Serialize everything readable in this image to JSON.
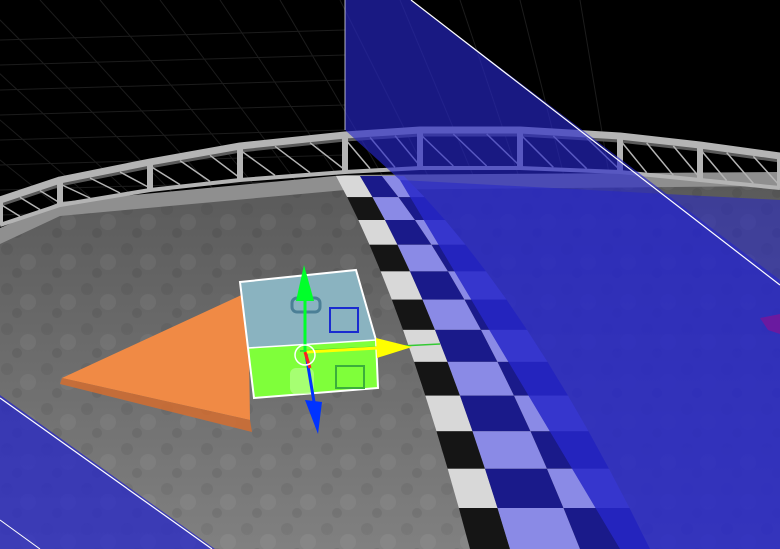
{
  "viewport": {
    "background_color": "#000000",
    "grid_color": "#1c1c1c"
  },
  "scene": {
    "floor_color": "#6e6e6e",
    "floor_dark_color": "#4c4c4c",
    "track_strip_dark": "#151515",
    "track_strip_light": "#d8d8d8",
    "railing_color": "#b4b4b4",
    "railing_shadow_color": "#5a5a5a"
  },
  "selection": {
    "volume_color": "#2626c8",
    "volume_opacity": 0.65,
    "object_fill_color": "#7fff3a",
    "object_top_color": "#8ab3c0",
    "outline_color": "#ffffff",
    "spawn_arrow_color": "#f08a45"
  },
  "gizmo": {
    "axis_x_color": "#ffff00",
    "axis_y_color": "#00ff2a",
    "axis_z_color": "#0033ff",
    "center_ring_color": "#ffffff",
    "x_line_color": "#34c934"
  }
}
